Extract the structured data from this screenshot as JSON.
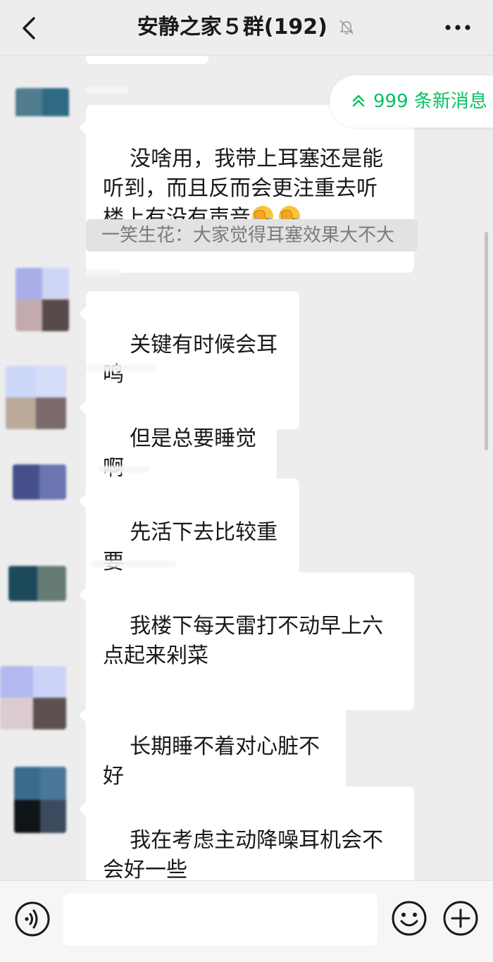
{
  "header": {
    "title": "安静之家５群(192)"
  },
  "new_messages": {
    "label": "999 条新消息"
  },
  "quote": {
    "text": "一笑生花：大家觉得耳塞效果大不大"
  },
  "messages": [
    {
      "text": "没啥用，我带上耳塞还是能听到，而且反而会更注重去听楼上有没有声音",
      "emojis": [
        "facepalm-laugh",
        "facepalm-laugh"
      ],
      "avatar_colors": [
        "#4f7c8f",
        "#2f6a85",
        "#ededed",
        "#ededed"
      ]
    },
    {
      "text": "关键有时候会耳鸣",
      "avatar_colors": [
        "#a8afe8",
        "#cfd6f5",
        "#c2aaaf",
        "#574a49"
      ]
    },
    {
      "text": "但是总要睡觉啊",
      "avatar_colors": [
        "#cdd7fa",
        "#d5dcf7",
        "#bba99a",
        "#7a6a6c"
      ]
    },
    {
      "text": "先活下去比较重要",
      "avatar_colors": [
        "#45508a",
        "#6b76b0",
        "#ededed",
        "#ededed"
      ]
    },
    {
      "text": "我楼下每天雷打不动早上六点起来剁菜",
      "avatar_colors": [
        "#1d4a5b",
        "#667b74",
        "#ededed",
        "#ededed"
      ]
    },
    {
      "text": "长期睡不着对心脏不好",
      "avatar_colors": [
        "#b4b8f0",
        "#cdd3f8",
        "#dccbd0",
        "#5d5050"
      ]
    },
    {
      "text": "我在考虑主动降噪耳机会不会好一些",
      "avatar_colors": [
        "#3a6b8c",
        "#4a7798",
        "#0f1418",
        "#3c4a5d"
      ]
    }
  ],
  "input": {
    "value": "",
    "placeholder": ""
  },
  "icons": {
    "back": "chevron-left-icon",
    "mute": "bell-off-icon",
    "more": "more-dots-icon",
    "new_messages": "double-chevron-up-icon",
    "voice": "voice-icon",
    "emoji": "smile-icon",
    "plus": "plus-circle-icon"
  },
  "colors": {
    "accent": "#07c160",
    "background": "#ededed",
    "bubble": "#ffffff"
  }
}
